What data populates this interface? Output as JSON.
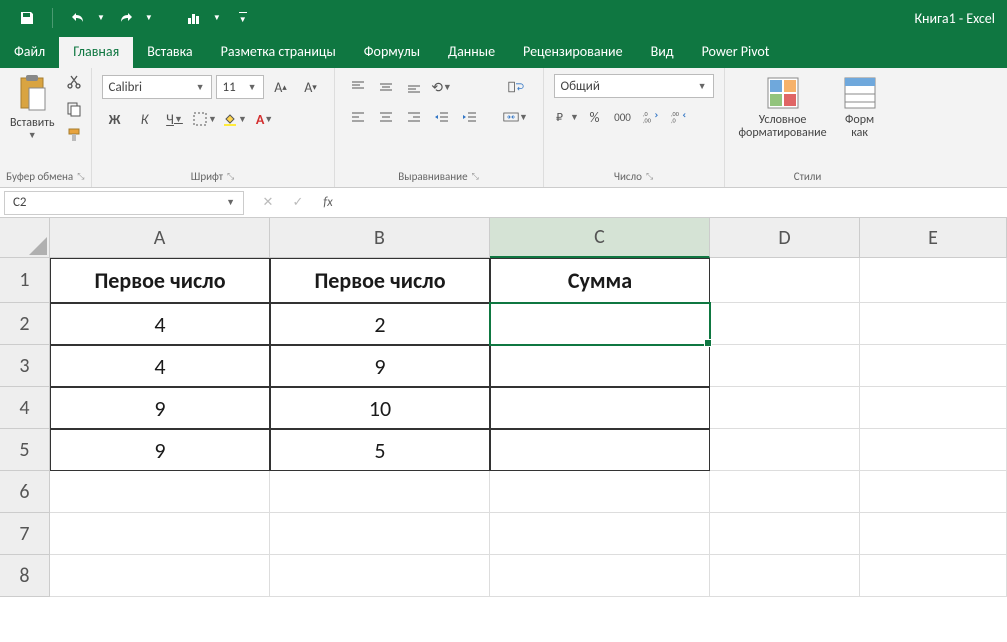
{
  "app": {
    "title": "Книга1 - Excel"
  },
  "qat": {
    "save": "save",
    "undo": "undo",
    "redo": "redo",
    "chart": "chart"
  },
  "tabs": {
    "file": "Файл",
    "home": "Главная",
    "insert": "Вставка",
    "layout": "Разметка страницы",
    "formulas": "Формулы",
    "data": "Данные",
    "review": "Рецензирование",
    "view": "Вид",
    "powerpivot": "Power Pivot"
  },
  "ribbon": {
    "clipboard": {
      "paste": "Вставить",
      "label": "Буфер обмена"
    },
    "font": {
      "name": "Calibri",
      "size": "11",
      "bold": "Ж",
      "italic": "К",
      "underline": "Ч",
      "label": "Шрифт"
    },
    "alignment": {
      "label": "Выравнивание"
    },
    "number": {
      "format": "Общий",
      "label": "Число"
    },
    "styles": {
      "cond_format": "Условное\nформатирование",
      "format_as": "Форм\nкак",
      "label": "Стили"
    }
  },
  "formulabar": {
    "name_box": "C2",
    "formula": ""
  },
  "grid": {
    "cols": [
      "A",
      "B",
      "C",
      "D",
      "E"
    ],
    "rows": [
      "1",
      "2",
      "3",
      "4",
      "5",
      "6",
      "7",
      "8"
    ],
    "headers": {
      "A1": "Первое число",
      "B1": "Первое число",
      "C1": "Сумма"
    },
    "data": {
      "A2": "4",
      "B2": "2",
      "A3": "4",
      "B3": "9",
      "A4": "9",
      "B4": "10",
      "A5": "9",
      "B5": "5"
    },
    "selected": "C2"
  }
}
